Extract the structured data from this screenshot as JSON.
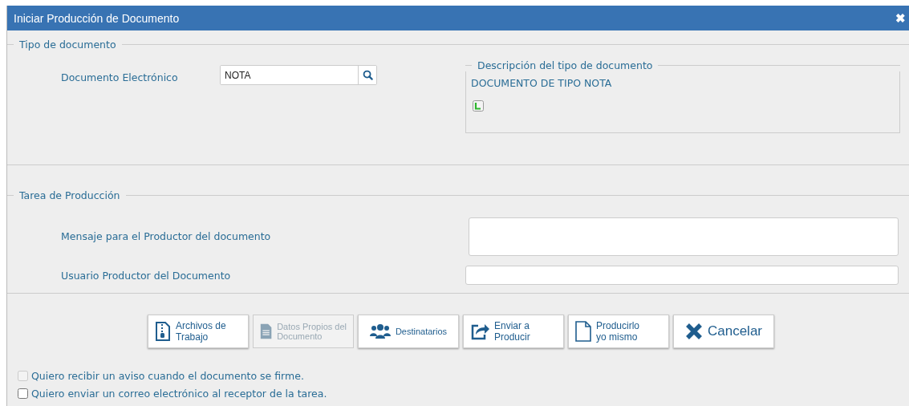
{
  "window": {
    "title": "Iniciar Producción de Documento",
    "close": "✖"
  },
  "tipo": {
    "legend": "Tipo de documento",
    "label": "Documento Electrónico",
    "value": "NOTA",
    "descripcion": {
      "legend": "Descripción del tipo de documento",
      "text": "DOCUMENTO DE TIPO NOTA"
    }
  },
  "tarea": {
    "legend": "Tarea de Producción",
    "fields": [
      {
        "label": "Mensaje para el Productor del documento",
        "kind": "textarea"
      },
      {
        "label": "Usuario Productor del Documento",
        "kind": "input"
      }
    ]
  },
  "buttons": [
    {
      "label": "Archivos de\nTrabajo",
      "kind": "archivos",
      "disabled": false
    },
    {
      "label": "Datos Propios del\nDocumento",
      "kind": "datos",
      "disabled": true
    },
    {
      "label": "Destinatarios",
      "kind": "destinatarios",
      "disabled": false
    },
    {
      "label": "Enviar a\nProducir",
      "kind": "enviar",
      "disabled": false
    },
    {
      "label": "Producirlo\nyo mismo",
      "kind": "producir",
      "disabled": false
    },
    {
      "label": "Cancelar",
      "kind": "cancelar",
      "disabled": false
    }
  ],
  "options": [
    {
      "label": "Quiero recibir un aviso cuando el documento se firme.",
      "checked": false,
      "disabled": true
    },
    {
      "label": "Quiero enviar un correo electrónico al receptor de la tarea.",
      "checked": false,
      "disabled": false
    }
  ]
}
